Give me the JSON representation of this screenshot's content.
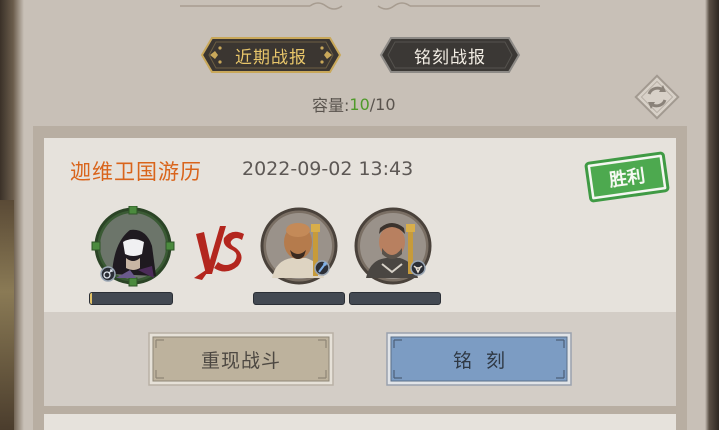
{
  "tabs": {
    "recent_label": "近期战报",
    "engrave_label": "铭刻战报"
  },
  "capacity": {
    "label": "容量:",
    "current": "10",
    "separator_max": "/10"
  },
  "report": {
    "title": "迦维卫国游历",
    "time": "2022-09-02 13:43",
    "result_badge": "胜利",
    "vs_text": "VS",
    "player_hp_fraction": 0.03,
    "enemy1_hp_fraction": 0,
    "enemy2_hp_fraction": 0
  },
  "buttons": {
    "replay_label": "重现战斗",
    "engrave_label": "铭刻"
  },
  "colors": {
    "title_orange": "#d9641b",
    "capacity_green": "#4f9a2a",
    "victory_green": "#3f9a44",
    "engrave_blue": "#7c9cc3",
    "replay_beige": "#bdb29d"
  },
  "icons": {
    "refresh": "refresh-icon",
    "player_class": "male-symbol-icon",
    "enemy1_class": "staff-icon",
    "enemy2_class": "bull-icon"
  }
}
